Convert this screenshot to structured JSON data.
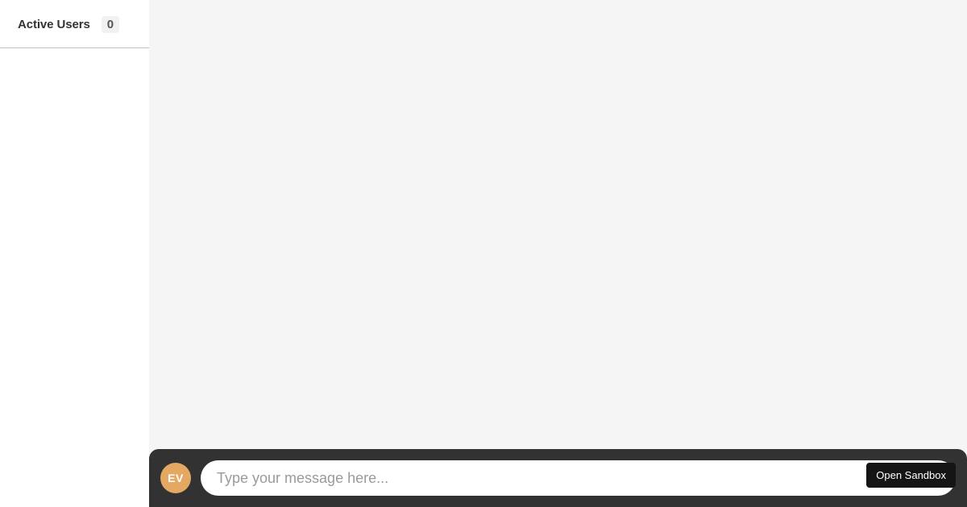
{
  "sidebar": {
    "title": "Active Users",
    "count": "0"
  },
  "composer": {
    "avatar_initials": "EV",
    "placeholder": "Type your message here..."
  },
  "sandbox": {
    "button_label": "Open Sandbox"
  },
  "colors": {
    "avatar_bg": "#e5a862",
    "composer_bg": "#323232",
    "sidebar_border": "#bfbfbf"
  }
}
